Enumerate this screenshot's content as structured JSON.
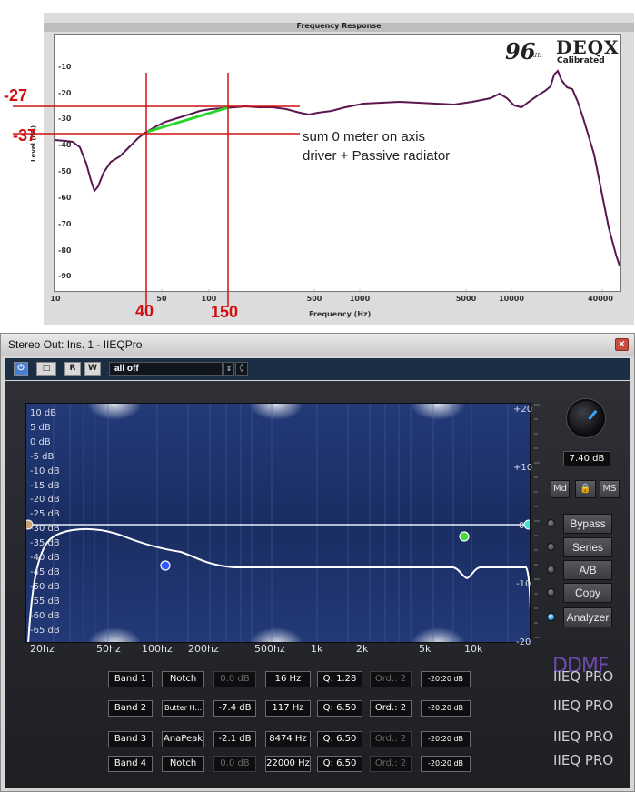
{
  "measurement": {
    "title": "Frequency Response",
    "x_axis_label": "Frequency (Hz)",
    "y_axis_label": "Level (dB)",
    "y_ticks": [
      "-10",
      "-20",
      "-30",
      "-40",
      "-50",
      "-60",
      "-70",
      "-80",
      "-90"
    ],
    "x_ticks": [
      "10",
      "50",
      "100",
      "500",
      "1000",
      "5000",
      "10000",
      "40000"
    ],
    "brand_96": "96",
    "brand_khz": "kHz",
    "brand_name": "DEQX",
    "brand_sub": "Calibrated",
    "mark_minus27": "-27",
    "mark_minus37": "-37",
    "mark_40": "40",
    "mark_150": "150",
    "annotation_line1": "sum 0 meter on axis",
    "annotation_line2": "driver + Passive radiator",
    "colors": {
      "marker": "#d01010",
      "fit": "#2bd62b",
      "trace": "#5a1650"
    }
  },
  "window": {
    "title": "Stereo Out: Ins. 1 - IIEQPro",
    "close_glyph": "×"
  },
  "toolbar": {
    "power_glyph": "⏻",
    "bypass_glyph": "□",
    "read_label": "R",
    "write_label": "W",
    "preset_value": "all off",
    "spin_glyph": "⇕",
    "menu_glyph": "◊"
  },
  "eq": {
    "db_labels": [
      "10 dB",
      "5 dB",
      "0 dB",
      "-5 dB",
      "-10 dB",
      "-15 dB",
      "-20 dB",
      "-25 dB",
      "-30 dB",
      "-35 dB",
      "-40 dB",
      "-45 dB",
      "-50 dB",
      "-55 dB",
      "-60 dB",
      "-65 dB"
    ],
    "freq_labels": [
      "20hz",
      "50hz",
      "100hz",
      "200hz",
      "500hz",
      "1k",
      "2k",
      "5k",
      "10k"
    ],
    "right_scale": [
      "+20",
      "+10",
      "0",
      "-10",
      "-20"
    ],
    "colors": {
      "background": "#182a5a",
      "curve": "#ffffff",
      "band1": "#c8a070",
      "band2": "#3355ff",
      "band3": "#44dd44",
      "band4": "#44dddd"
    }
  },
  "controls": {
    "gain_value": "7.40 dB",
    "md_label": "Md",
    "lock_glyph": "🔒",
    "ms_label": "MS",
    "side_buttons": [
      "Bypass",
      "Series",
      "A/B",
      "Copy",
      "Analyzer"
    ],
    "logo": "DDMF",
    "product_label": "IIEQ PRO"
  },
  "bands": [
    {
      "name": "Band 1",
      "type": "Notch",
      "gain": "0.0 dB",
      "gain_active": false,
      "freq": "16 Hz",
      "q": "Q: 1.28",
      "q_active": true,
      "order": "Ord.: 2",
      "order_active": false,
      "range": "-20:20 dB"
    },
    {
      "name": "Band 2",
      "type": "Butter H...",
      "gain": "-7.4 dB",
      "gain_active": true,
      "freq": "117 Hz",
      "q": "Q: 6.50",
      "q_active": true,
      "order": "Ord.: 2",
      "order_active": true,
      "range": "-20:20 dB"
    },
    {
      "name": "Band 3",
      "type": "AnaPeak",
      "gain": "-2.1 dB",
      "gain_active": true,
      "freq": "8474 Hz",
      "q": "Q: 6.50",
      "q_active": true,
      "order": "Ord.: 2",
      "order_active": false,
      "range": "-20:20 dB"
    },
    {
      "name": "Band 4",
      "type": "Notch",
      "gain": "0.0 dB",
      "gain_active": false,
      "freq": "22000 Hz",
      "q": "Q: 6.50",
      "q_active": true,
      "order": "Ord.: 2",
      "order_active": false,
      "range": "-20:20 dB"
    }
  ]
}
